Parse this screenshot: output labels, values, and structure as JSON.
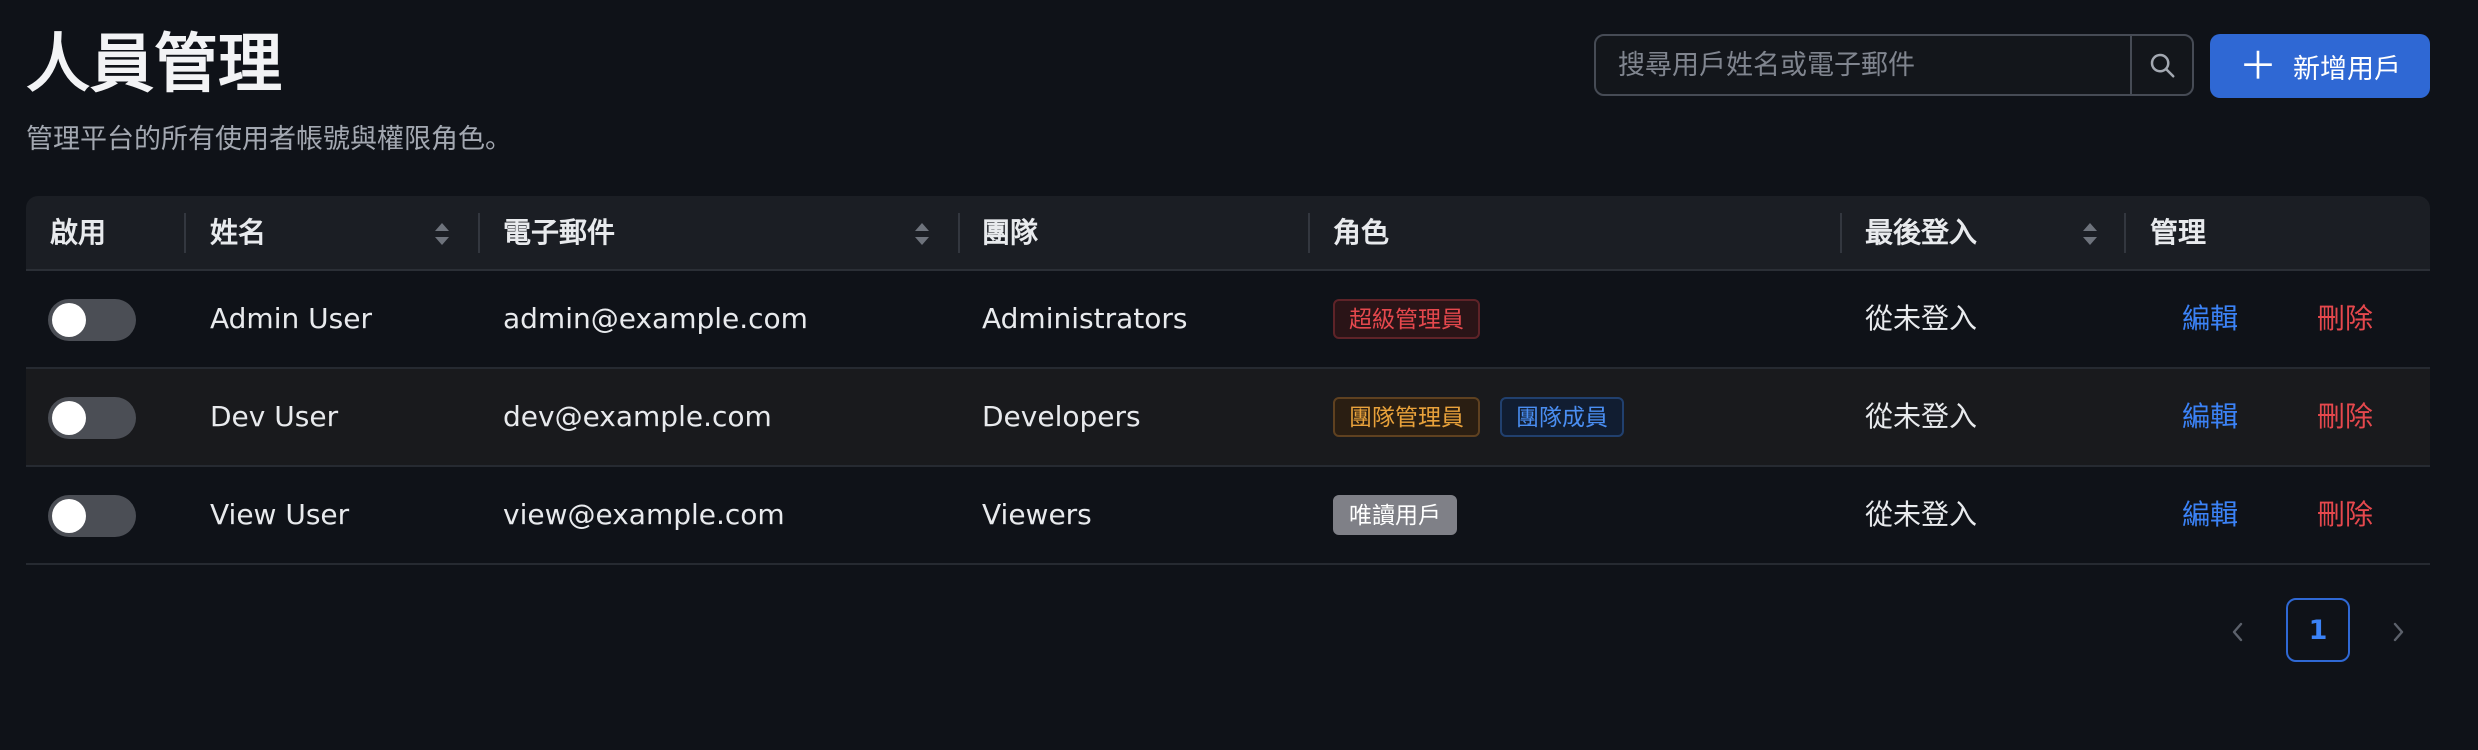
{
  "header": {
    "title": "人員管理",
    "subtitle": "管理平台的所有使用者帳號與權限角色。"
  },
  "search": {
    "placeholder": "搜尋用戶姓名或電子郵件",
    "icon": "search-icon"
  },
  "add_button": {
    "icon": "plus-icon",
    "label": "新增用戶"
  },
  "table": {
    "columns": {
      "enabled": "啟用",
      "name": "姓名",
      "email": "電子郵件",
      "team": "團隊",
      "roles": "角色",
      "last_login": "最後登入",
      "actions": "管理"
    },
    "sortable_columns": [
      "name",
      "email",
      "last_login"
    ],
    "rows": [
      {
        "enabled": false,
        "name": "Admin User",
        "email": "admin@example.com",
        "team": "Administrators",
        "roles": [
          {
            "label": "超級管理員",
            "color": "#e5484d"
          }
        ],
        "last_login": "從未登入",
        "edit_label": "編輯",
        "delete_label": "刪除"
      },
      {
        "enabled": false,
        "name": "Dev User",
        "email": "dev@example.com",
        "team": "Developers",
        "roles": [
          {
            "label": "團隊管理員",
            "color": "#e9a23b"
          },
          {
            "label": "團隊成員",
            "color": "#4a8ef2"
          }
        ],
        "last_login": "從未登入",
        "edit_label": "編輯",
        "delete_label": "刪除"
      },
      {
        "enabled": false,
        "name": "View User",
        "email": "view@example.com",
        "team": "Viewers",
        "roles": [
          {
            "label": "唯讀用戶",
            "color": "#7f8087"
          }
        ],
        "last_login": "從未登入",
        "edit_label": "編輯",
        "delete_label": "刪除"
      }
    ]
  },
  "pagination": {
    "current_page": "1",
    "prev_icon": "chevron-left-icon",
    "next_icon": "chevron-right-icon"
  },
  "colors": {
    "background": "#0f1218",
    "primary": "#2f68d4",
    "link": "#3b82f6",
    "danger": "#e5484d"
  }
}
